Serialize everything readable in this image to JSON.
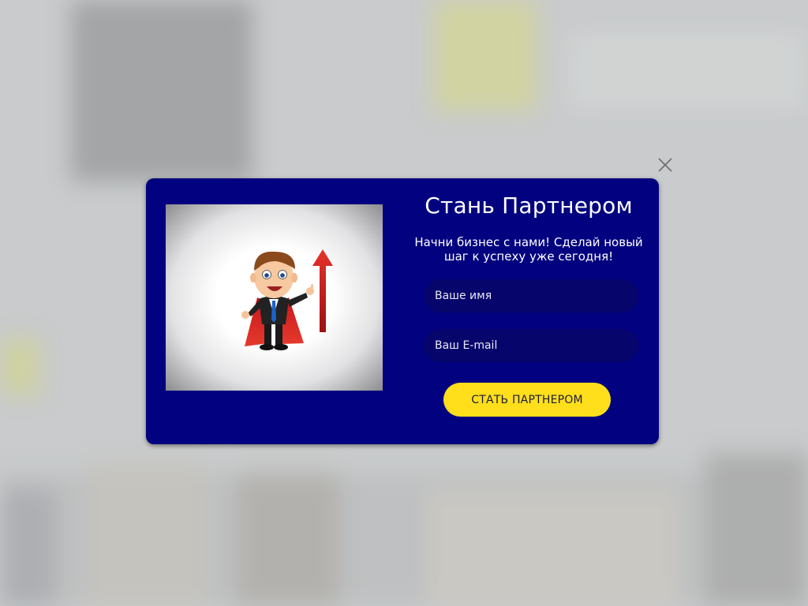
{
  "colors": {
    "modal_background": "#02017f",
    "input_background": "#05056b",
    "button_background": "#ffdf1b",
    "text": "#ffffff"
  },
  "modal": {
    "title": "Стань Партнером",
    "subtitle": "Начни бизнес с нами! Сделай новый шаг к успеху уже сегодня!",
    "name_field": {
      "placeholder": "Ваше имя",
      "value": ""
    },
    "email_field": {
      "placeholder": "Ваш E-mail",
      "value": ""
    },
    "submit_label": "СТАТЬ ПАРТНЕРОМ",
    "image_icon": "businessman-superhero-growth-arrow",
    "close_icon": "close-icon"
  }
}
